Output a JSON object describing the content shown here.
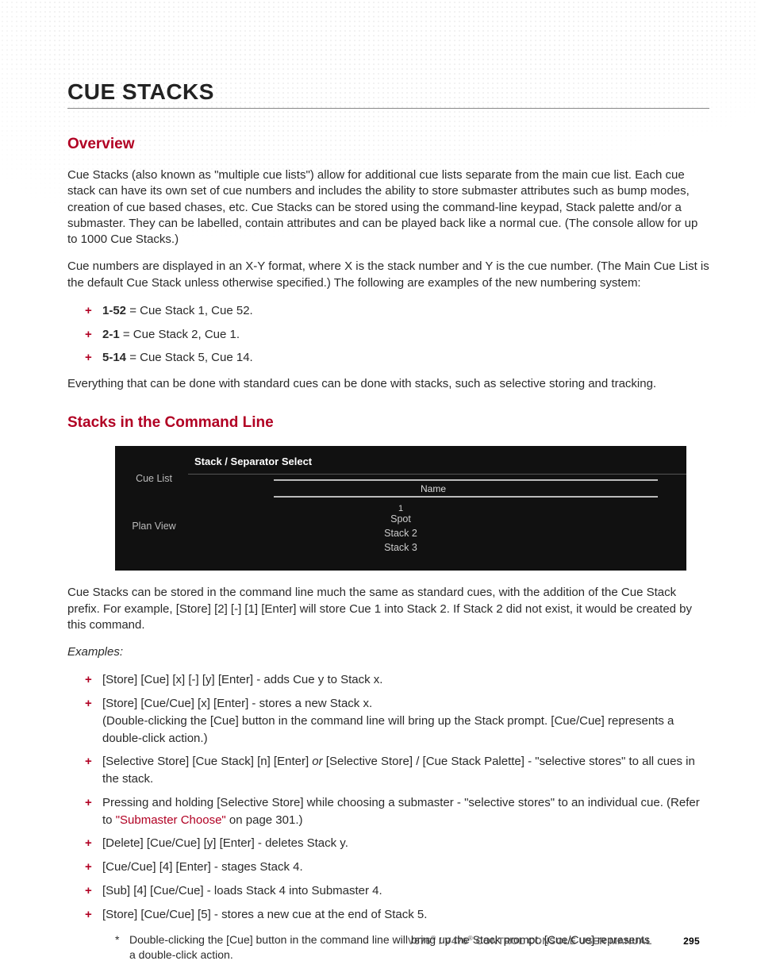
{
  "title": "CUE STACKS",
  "sections": {
    "overview": {
      "heading": "Overview",
      "para1": "Cue Stacks (also known as \"multiple cue lists\") allow for additional cue lists separate from the main cue list. Each cue stack can have its own set of cue numbers and includes the ability to store submaster attributes such as bump modes, creation of cue based chases, etc. Cue Stacks can be stored using the command-line keypad, Stack palette and/or a submaster. They can be labelled, contain attributes and can be played back like a normal cue. (The console allow for up to 1000 Cue Stacks.)",
      "para2": "Cue numbers are displayed in an X-Y format, where X is the stack number and Y is the cue number. (The Main Cue List is the default Cue Stack unless otherwise specified.) The following are examples of the new numbering system:",
      "examples": [
        {
          "code": "1-52",
          "desc": " = Cue Stack 1, Cue 52."
        },
        {
          "code": "2-1",
          "desc": " = Cue Stack 2, Cue 1."
        },
        {
          "code": "5-14",
          "desc": " = Cue Stack 5, Cue 14."
        }
      ],
      "para3": "Everything that can be done with standard cues can be done with stacks, such as selective storing and tracking."
    },
    "cmdline": {
      "heading": "Stacks in the Command Line",
      "shot": {
        "header": "Stack / Separator Select",
        "leftItems": [
          "Cue List",
          "Plan View"
        ],
        "nameLabel": "Name",
        "rows": [
          {
            "num": "1",
            "name": "Spot"
          },
          {
            "num": "",
            "name": "Stack 2"
          },
          {
            "num": "",
            "name": "Stack 3"
          }
        ]
      },
      "para1": "Cue Stacks can be stored in the command line much the same as standard cues, with the addition of the Cue Stack prefix. For example, [Store] [2] [-] [1] [Enter] will store Cue 1 into Stack 2. If Stack 2 did not exist, it would be created by this command.",
      "examplesLabel": "Examples:",
      "bullets": [
        "[Store] [Cue] [x] [-] [y] [Enter] - adds Cue y to Stack x.",
        "[Store] [Cue/Cue] [x] [Enter] - stores a new Stack x.\n(Double-clicking the [Cue] button in the command line will bring up the Stack prompt. [Cue/Cue] represents a double-click action.)",
        "[Selective Store] [Cue Stack] [n] [Enter] <i>or</i> [Selective Store] / [Cue Stack Palette] - \"selective stores\" to all cues in the stack.",
        "Pressing and holding [Selective Store] while choosing a submaster - \"selective stores\" to an individual cue. (Refer to <link>\"Submaster Choose\"</link> on page 301.)",
        "[Delete] [Cue/Cue] [y] [Enter] - deletes Stack y.",
        "[Cue/Cue] [4] [Enter] - stages Stack 4.",
        "[Sub] [4] [Cue/Cue] - loads Stack 4 into Submaster 4.",
        "[Store] [Cue/Cue] [5] - stores a new cue at the end of Stack 5."
      ],
      "footnote": "Double-clicking the [Cue] button in the command line will bring up the Stack prompt. [Cue/Cue] represents a double-click action."
    }
  },
  "footer": {
    "textParts": [
      "V676",
      "®",
      " / V476",
      "®",
      " CONTROL CONSOLE USER MANUAL"
    ],
    "page": "295"
  }
}
